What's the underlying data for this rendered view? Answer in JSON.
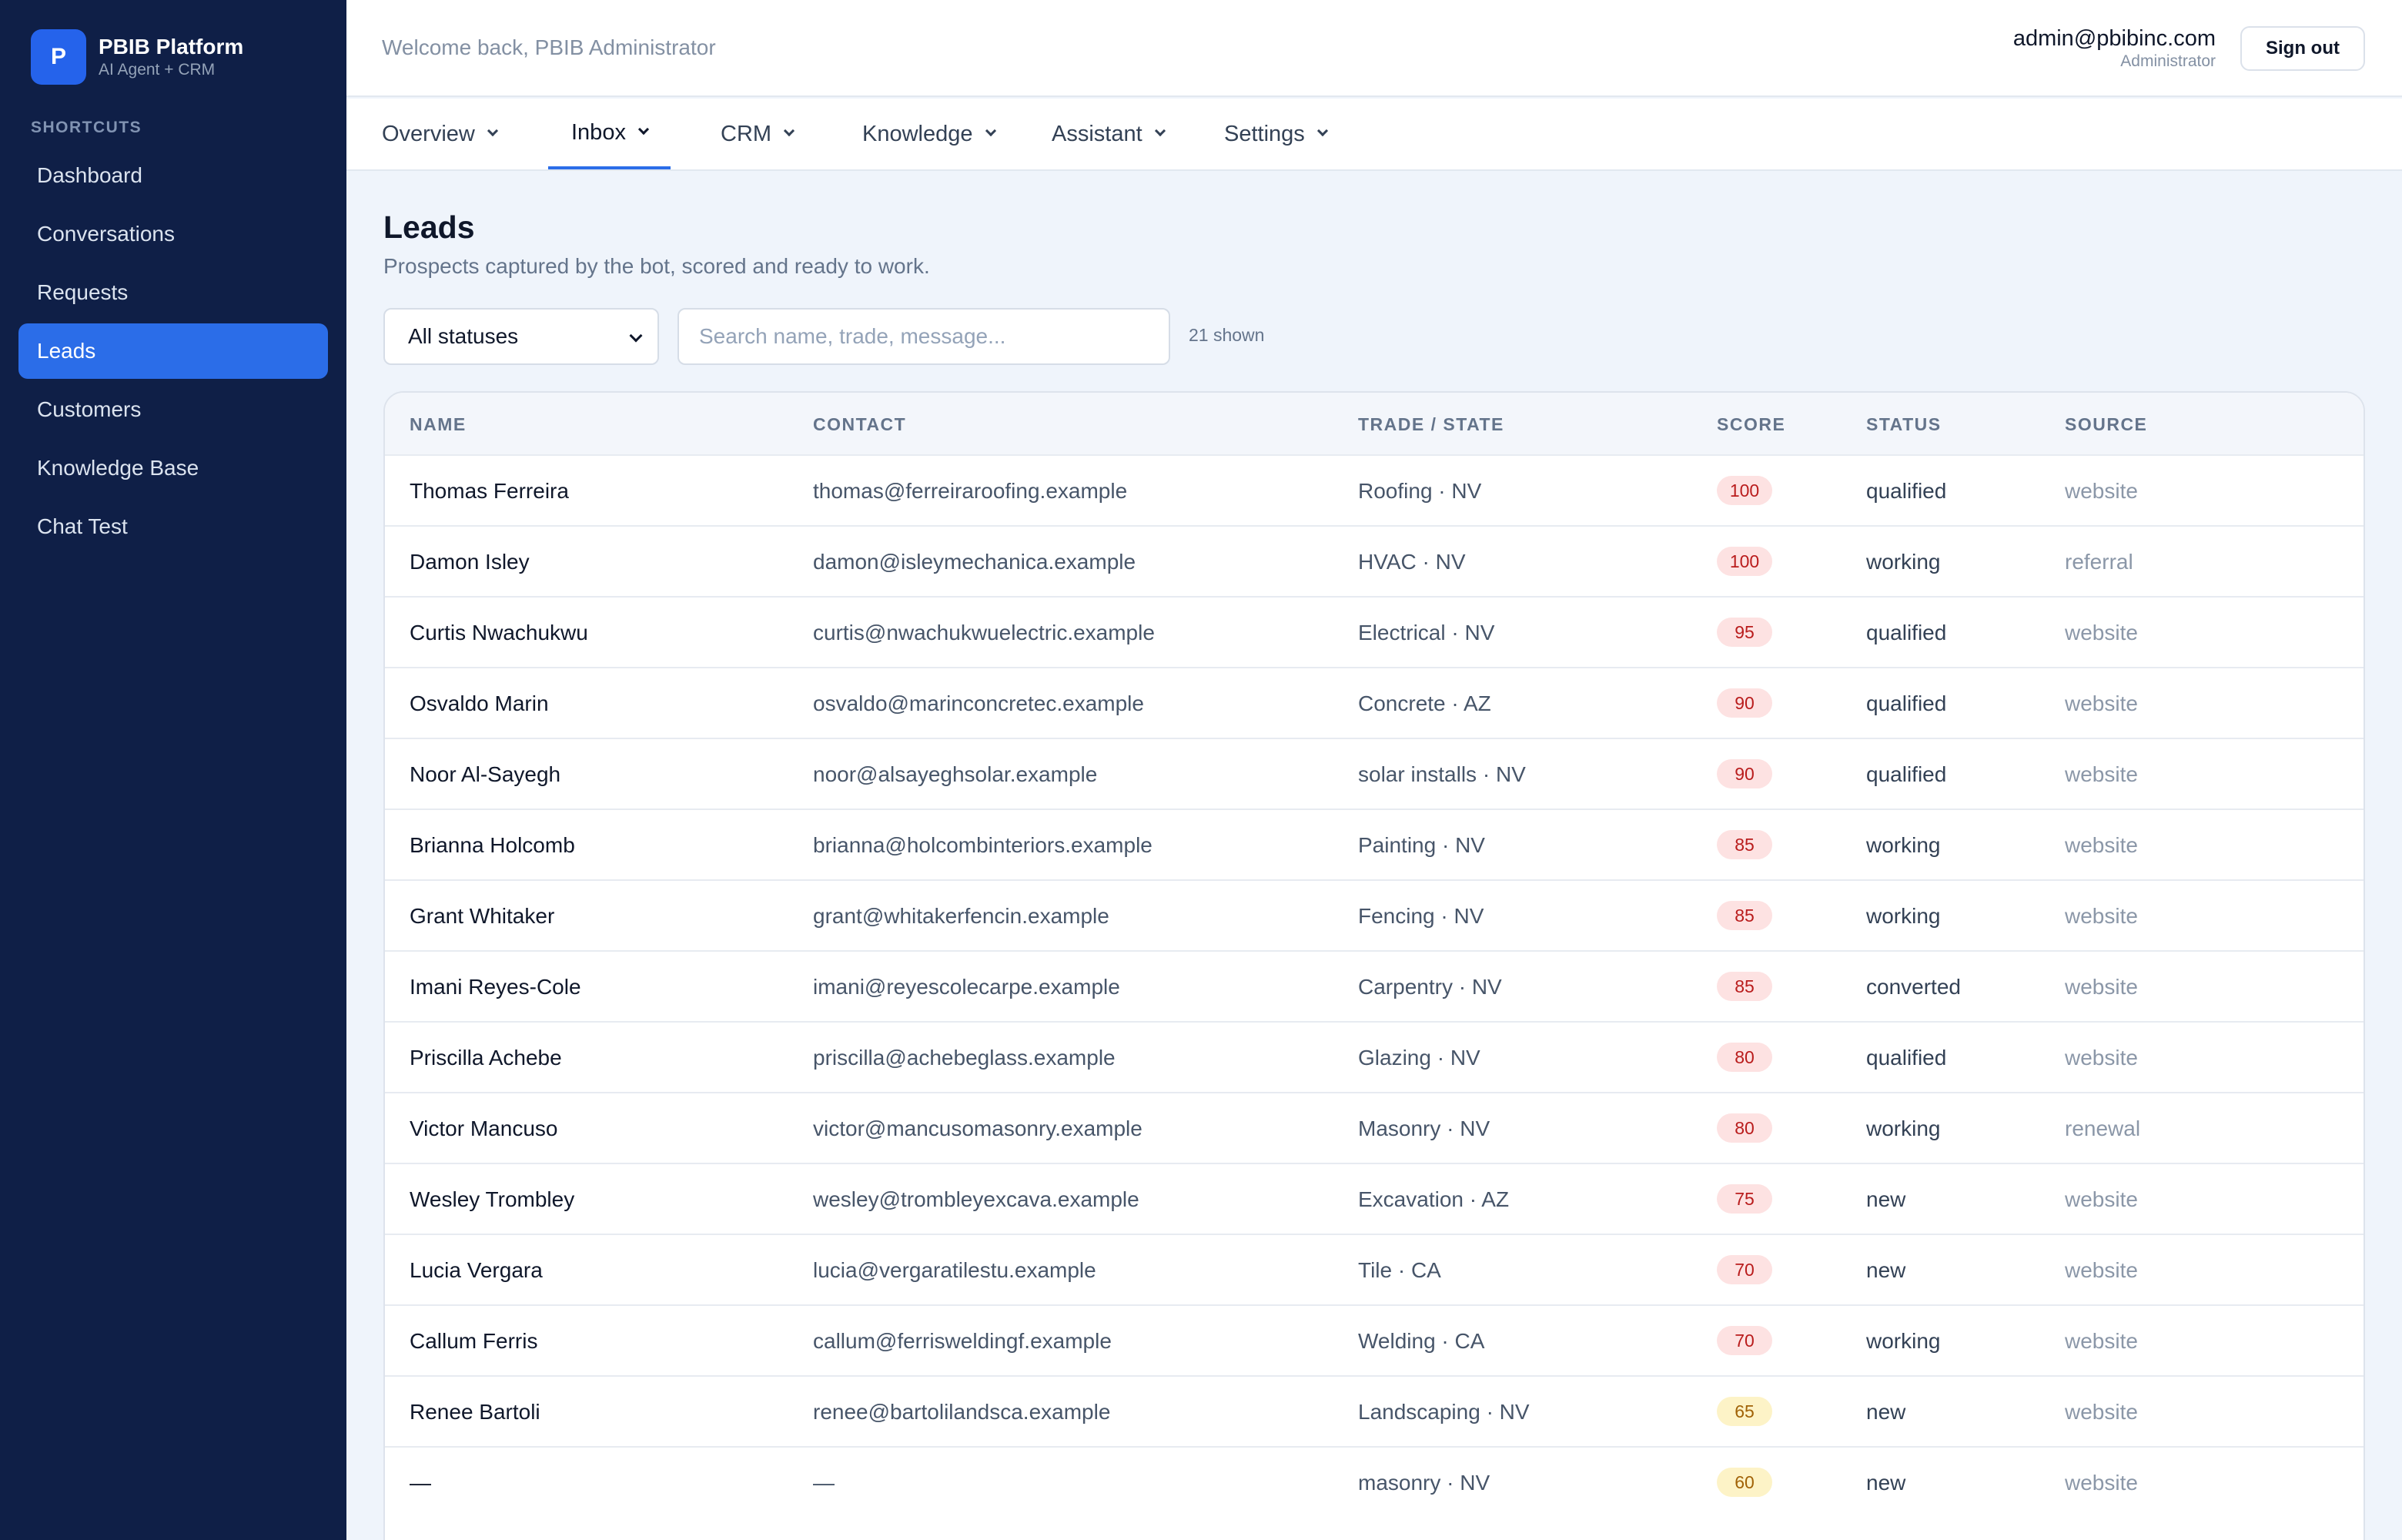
{
  "brand": {
    "logo_letter": "P",
    "title": "PBIB Platform",
    "subtitle": "AI Agent + CRM"
  },
  "sidebar": {
    "section_label": "SHORTCUTS",
    "items": [
      {
        "label": "Dashboard",
        "active": false
      },
      {
        "label": "Conversations",
        "active": false
      },
      {
        "label": "Requests",
        "active": false
      },
      {
        "label": "Leads",
        "active": true
      },
      {
        "label": "Customers",
        "active": false
      },
      {
        "label": "Knowledge Base",
        "active": false
      },
      {
        "label": "Chat Test",
        "active": false
      }
    ]
  },
  "header": {
    "welcome": "Welcome back, PBIB Administrator",
    "user_email": "admin@pbibinc.com",
    "user_role": "Administrator",
    "signout_label": "Sign out"
  },
  "tabs": [
    {
      "label": "Overview",
      "active": false
    },
    {
      "label": "Inbox",
      "active": true
    },
    {
      "label": "CRM",
      "active": false
    },
    {
      "label": "Knowledge",
      "active": false
    },
    {
      "label": "Assistant",
      "active": false
    },
    {
      "label": "Settings",
      "active": false
    }
  ],
  "page": {
    "title": "Leads",
    "subtitle": "Prospects captured by the bot, scored and ready to work.",
    "filter_value": "All statuses",
    "search_placeholder": "Search name, trade, message...",
    "shown_count": "21 shown"
  },
  "table": {
    "columns": [
      "NAME",
      "CONTACT",
      "TRADE / STATE",
      "SCORE",
      "STATUS",
      "SOURCE"
    ],
    "rows": [
      {
        "name": "Thomas Ferreira",
        "contact": "thomas@ferreiraroofing.example",
        "trade": "Roofing · NV",
        "score": "100",
        "status": "qualified",
        "source": "website"
      },
      {
        "name": "Damon Isley",
        "contact": "damon@isleymechanica.example",
        "trade": "HVAC · NV",
        "score": "100",
        "status": "working",
        "source": "referral"
      },
      {
        "name": "Curtis Nwachukwu",
        "contact": "curtis@nwachukwuelectric.example",
        "trade": "Electrical · NV",
        "score": "95",
        "status": "qualified",
        "source": "website"
      },
      {
        "name": "Osvaldo Marin",
        "contact": "osvaldo@marinconcretec.example",
        "trade": "Concrete · AZ",
        "score": "90",
        "status": "qualified",
        "source": "website"
      },
      {
        "name": "Noor Al-Sayegh",
        "contact": "noor@alsayeghsolar.example",
        "trade": "solar installs · NV",
        "score": "90",
        "status": "qualified",
        "source": "website"
      },
      {
        "name": "Brianna Holcomb",
        "contact": "brianna@holcombinteriors.example",
        "trade": "Painting · NV",
        "score": "85",
        "status": "working",
        "source": "website"
      },
      {
        "name": "Grant Whitaker",
        "contact": "grant@whitakerfencin.example",
        "trade": "Fencing · NV",
        "score": "85",
        "status": "working",
        "source": "website"
      },
      {
        "name": "Imani Reyes-Cole",
        "contact": "imani@reyescolecarpe.example",
        "trade": "Carpentry · NV",
        "score": "85",
        "status": "converted",
        "source": "website"
      },
      {
        "name": "Priscilla Achebe",
        "contact": "priscilla@achebeglass.example",
        "trade": "Glazing · NV",
        "score": "80",
        "status": "qualified",
        "source": "website"
      },
      {
        "name": "Victor Mancuso",
        "contact": "victor@mancusomasonry.example",
        "trade": "Masonry · NV",
        "score": "80",
        "status": "working",
        "source": "renewal"
      },
      {
        "name": "Wesley Trombley",
        "contact": "wesley@trombleyexcava.example",
        "trade": "Excavation · AZ",
        "score": "75",
        "status": "new",
        "source": "website"
      },
      {
        "name": "Lucia Vergara",
        "contact": "lucia@vergaratilestu.example",
        "trade": "Tile · CA",
        "score": "70",
        "status": "new",
        "source": "website"
      },
      {
        "name": "Callum Ferris",
        "contact": "callum@ferrisweldingf.example",
        "trade": "Welding · CA",
        "score": "70",
        "status": "working",
        "source": "website"
      },
      {
        "name": "Renee Bartoli",
        "contact": "renee@bartolilandsca.example",
        "trade": "Landscaping · NV",
        "score": "65",
        "status": "new",
        "source": "website"
      },
      {
        "name": "—",
        "contact": "—",
        "trade": "masonry · NV",
        "score": "60",
        "status": "new",
        "source": "website"
      }
    ]
  },
  "colors": {
    "sidebar_bg": "#0f1f47",
    "accent": "#2b6de8",
    "score_high_bg": "#fde2e2",
    "score_mid_bg": "#fdf3c7"
  }
}
